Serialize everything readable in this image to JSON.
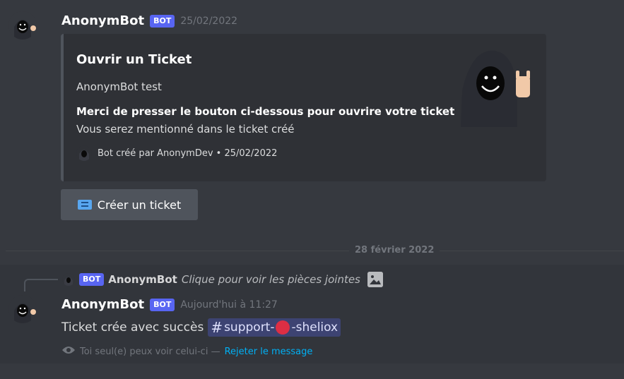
{
  "message1": {
    "username": "AnonymBot",
    "bot_tag": "BOT",
    "timestamp": "25/02/2022",
    "embed": {
      "title": "Ouvrir un Ticket",
      "description": "AnonymBot test",
      "field_name": "Merci de presser le bouton ci-dessous pour ouvrire votre ticket",
      "field_value": "Vous serez mentionné dans le ticket créé",
      "footer": "Bot créé par AnonymDev • 25/02/2022"
    },
    "button": {
      "label": "Créer un ticket",
      "icon": "ticket-icon"
    }
  },
  "divider": {
    "date": "28 février 2022"
  },
  "message2": {
    "reply": {
      "bot_tag": "BOT",
      "username": "AnonymBot",
      "content": "Clique pour voir les pièces jointes",
      "icon": "image-icon"
    },
    "username": "AnonymBot",
    "bot_tag": "BOT",
    "timestamp": "Aujourd'hui à 11:27",
    "text": "Ticket crée avec succès",
    "mention": {
      "prefix": "#",
      "name_start": "support-",
      "name_end": "-sheliox"
    },
    "ephemeral": {
      "text": "Toi seul(e) peux voir celui-ci —",
      "dismiss": "Rejeter le message",
      "icon": "eye-icon"
    }
  },
  "colors": {
    "background": "#36393f",
    "embed_bg": "#2f3136",
    "bot_tag": "#5865f2",
    "link": "#00b0f4",
    "mention_bg": "#414675"
  }
}
